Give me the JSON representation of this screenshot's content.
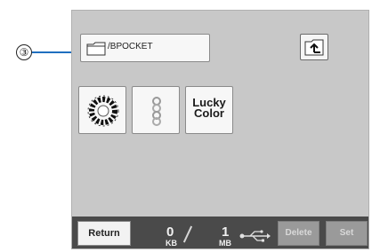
{
  "callout": {
    "number": "③"
  },
  "folder": {
    "path": "/BPOCKET",
    "icon": "folder-icon"
  },
  "up_button": {
    "icon": "folder-up-icon"
  },
  "tiles": [
    {
      "icon": "wreath-design-icon"
    },
    {
      "icon": "chain-design-icon"
    },
    {
      "line1": "Lucky",
      "line2": "Color"
    }
  ],
  "bottom": {
    "return_label": "Return",
    "memory_used_value": "0",
    "memory_used_unit": "KB",
    "memory_total_value": "1",
    "memory_total_unit": "MB",
    "usb_icon": "usb-icon",
    "delete_label": "Delete",
    "set_label": "Set"
  },
  "colors": {
    "screen": "#c8c8c8",
    "bar": "#4a4a4a",
    "callout_line": "#1f6fbf"
  }
}
